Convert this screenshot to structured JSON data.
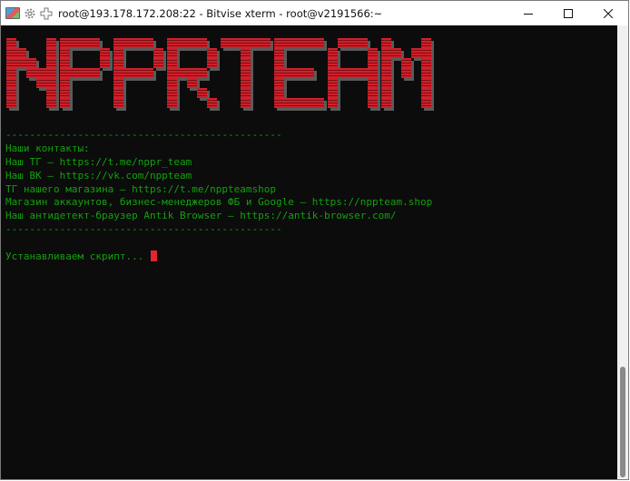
{
  "window": {
    "title": "root@193.178.172.208:22 - Bitvise xterm - root@v2191566:~",
    "icons": [
      "app-icon",
      "gear-icon",
      "plus-icon"
    ],
    "controls": [
      "minimize-icon",
      "maximize-icon",
      "close-icon"
    ]
  },
  "banner": {
    "text": "NPPRTEAM",
    "color": "#d0202a"
  },
  "terminal": {
    "text_color": "#13a10e",
    "lines": [
      "----------------------------------------------",
      "Наши контакты:",
      "Наш ТГ — https://t.me/nppr_team",
      "Наш ВК — https://vk.com/nppteam",
      "ТГ нашего магазина — https://t.me/nppteamshop",
      "Магазин аккаунтов, бизнес-менеджеров ФБ и Google — https://nppteam.shop",
      "Наш антидетект-браузер Antik Browser — https://antik-browser.com/",
      "----------------------------------------------",
      "",
      "Устанавливаем скрипт... "
    ]
  }
}
